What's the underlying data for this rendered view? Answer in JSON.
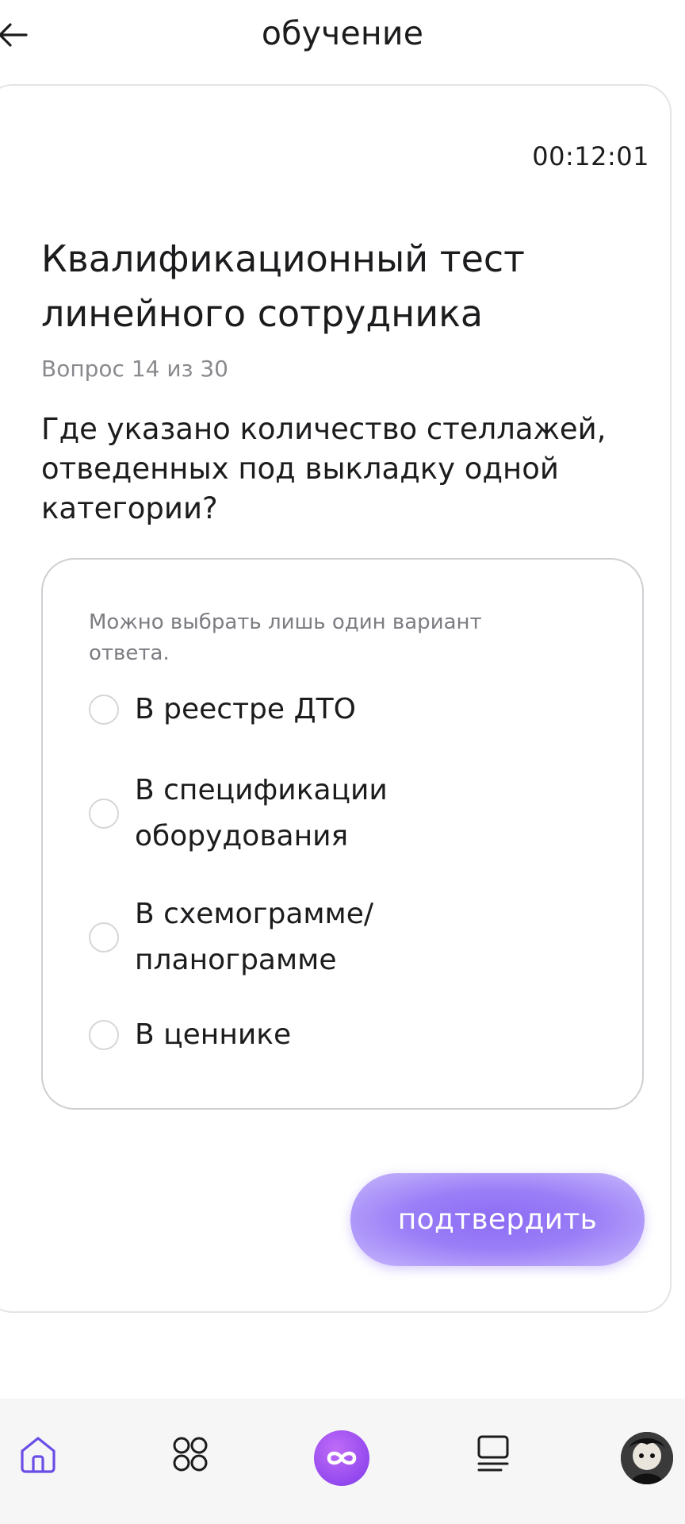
{
  "header": {
    "title": "обучение",
    "back_icon": "arrow-left-icon"
  },
  "test": {
    "timer": "00:12:01",
    "title": "Квалификационный тест линейного сотрудника",
    "progress": "Вопрос 14 из 30",
    "question": "Где указано количество стеллажей, отведенных под выкладку одной категории?"
  },
  "answers": {
    "hint": "Можно выбрать лишь один вариант ответа.",
    "options": [
      {
        "label": "В реестре ДТО",
        "selected": false
      },
      {
        "label": "В спецификации оборудования",
        "selected": false
      },
      {
        "label": "В схемограмме/ планограмме",
        "selected": false
      },
      {
        "label": "В ценнике",
        "selected": false
      }
    ]
  },
  "actions": {
    "confirm_label": "подтвердить",
    "accent_color": "#8c6cf4"
  },
  "tabbar": {
    "items": [
      {
        "icon": "home-icon",
        "active": true
      },
      {
        "icon": "grid-icon",
        "active": false
      },
      {
        "icon": "infinity-icon",
        "active": false
      },
      {
        "icon": "list-icon",
        "active": false
      },
      {
        "icon": "avatar",
        "active": false
      }
    ],
    "active_color": "#6b4ee6"
  }
}
